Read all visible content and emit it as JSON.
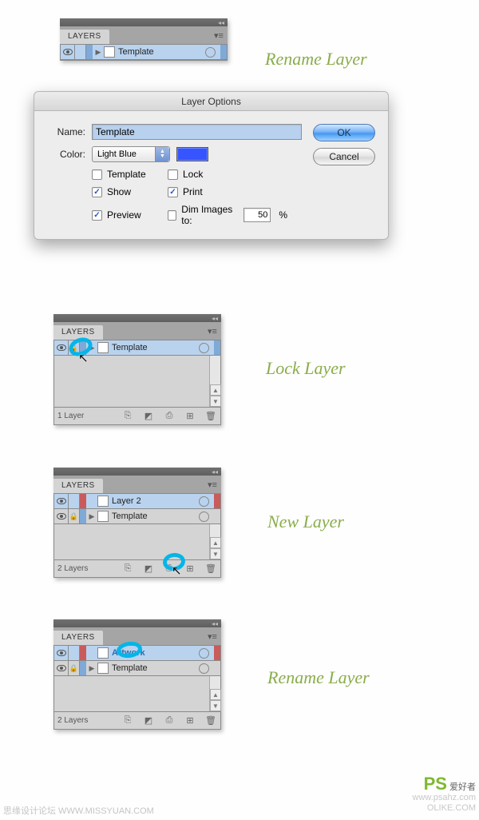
{
  "captions": {
    "rename1": "Rename Layer",
    "lock": "Lock Layer",
    "new": "New Layer",
    "rename2": "Rename Layer"
  },
  "panel": {
    "title": "LAYERS",
    "layer_template": "Template",
    "layer2": "Layer 2",
    "artwork": "Artwork",
    "foot1": "1 Layer",
    "foot2": "2 Layers"
  },
  "dialog": {
    "title": "Layer Options",
    "name_label": "Name:",
    "name_value": "Template",
    "color_label": "Color:",
    "color_value": "Light Blue",
    "cb_template": "Template",
    "cb_lock": "Lock",
    "cb_show": "Show",
    "cb_print": "Print",
    "cb_preview": "Preview",
    "cb_dim": "Dim Images to:",
    "dim_value": "50",
    "pct": "%",
    "ok": "OK",
    "cancel": "Cancel"
  },
  "watermarks": {
    "left": "思缘设计论坛  WWW.MISSYUAN.COM",
    "right_ch": "爱好者",
    "right_en": "www.psahz.com",
    "olike": "OLIKE.COM"
  },
  "colors": {
    "light_blue_bar": "#7fa9d6",
    "red_bar": "#c95b5b"
  }
}
